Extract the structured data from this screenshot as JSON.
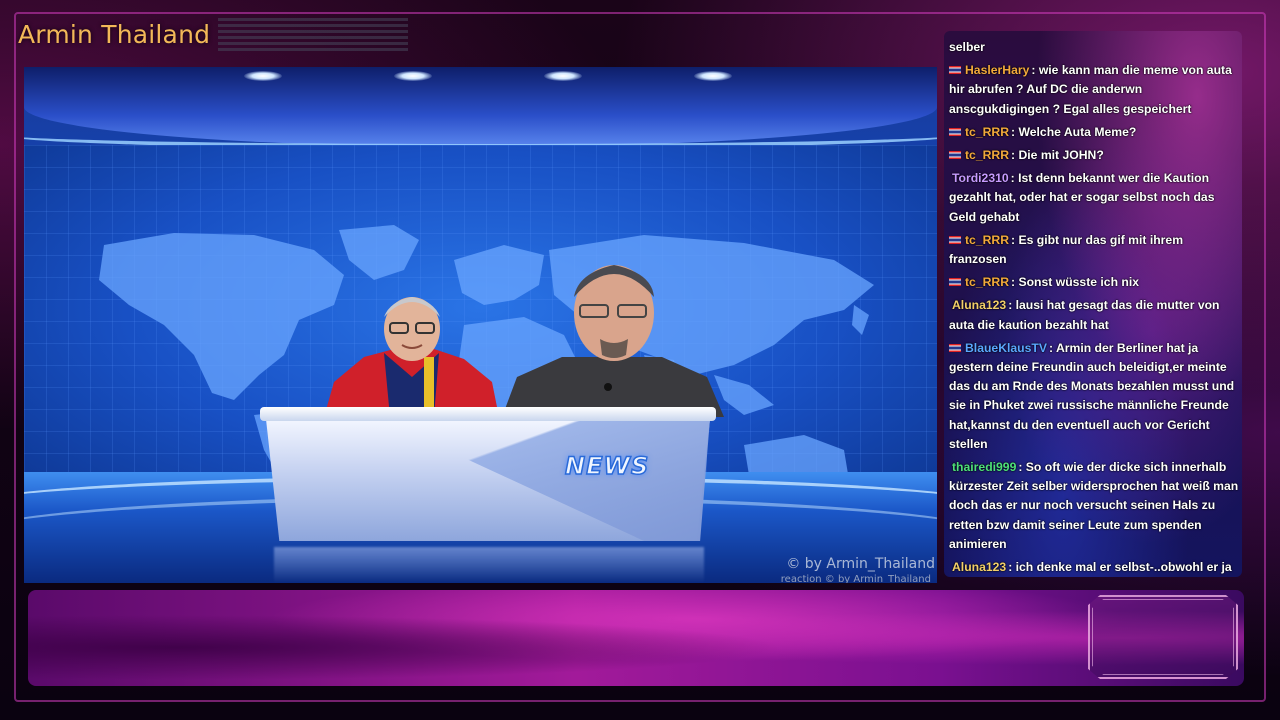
{
  "channel": {
    "title": "Armin Thailand"
  },
  "video": {
    "desk_logo": "NEWS",
    "watermark_main": "© by Armin_Thailand",
    "watermark_sub": "reaction  © by Armin_Thailand"
  },
  "chat": {
    "messages": [
      {
        "user": "",
        "text": "selber",
        "flag": false,
        "user_color": "#ffffff"
      },
      {
        "user": "HaslerHary",
        "text": ": wie kann man die meme von auta hir abrufen ? Auf DC die anderwn anscgukdigingen ? Egal alles gespeichert",
        "flag": true,
        "user_color": "#f2a93c"
      },
      {
        "user": "tc_RRR",
        "text": ": Welche Auta Meme?",
        "flag": true,
        "user_color": "#f2a93c"
      },
      {
        "user": "tc_RRR",
        "text": ": Die mit JOHN?",
        "flag": true,
        "user_color": "#f2a93c"
      },
      {
        "user": "Tordi2310",
        "text": ": Ist denn bekannt wer die Kaution gezahlt hat, oder hat er sogar selbst noch das Geld gehabt",
        "flag": false,
        "user_color": "#c79bff"
      },
      {
        "user": "tc_RRR",
        "text": ": Es gibt nur das gif mit ihrem franzosen",
        "flag": true,
        "user_color": "#f2a93c"
      },
      {
        "user": "tc_RRR",
        "text": ": Sonst wüsste ich nix",
        "flag": true,
        "user_color": "#f2a93c"
      },
      {
        "user": "Aluna123",
        "text": ": lausi hat gesagt das die mutter von auta die kaution bezahlt hat",
        "flag": false,
        "user_color": "#f2cf6a"
      },
      {
        "user": "BlaueKlausTV",
        "text": ": Armin der Berliner hat ja gestern deine Freundin auch beleidigt,er meinte das du am Rnde des Monats bezahlen musst und sie in Phuket zwei russische männliche Freunde hat,kannst du den eventuell auch vor Gericht stellen",
        "flag": true,
        "user_color": "#5aa7ff"
      },
      {
        "user": "thairedi999",
        "text": ": So oft wie der dicke sich innerhalb kürzester Zeit selber widersprochen hat weiß man doch das er nur noch versucht seinen Hals zu retten bzw damit seiner Leute zum spenden animieren",
        "flag": false,
        "user_color": "#4ee07a"
      },
      {
        "user": "Aluna123",
        "text": ": ich denke mal er selbst-..obwohl er ja kein geld hat",
        "flag": false,
        "user_color": "#f2cf6a"
      }
    ]
  },
  "icons": {
    "flag": "thai-flag-icon"
  }
}
